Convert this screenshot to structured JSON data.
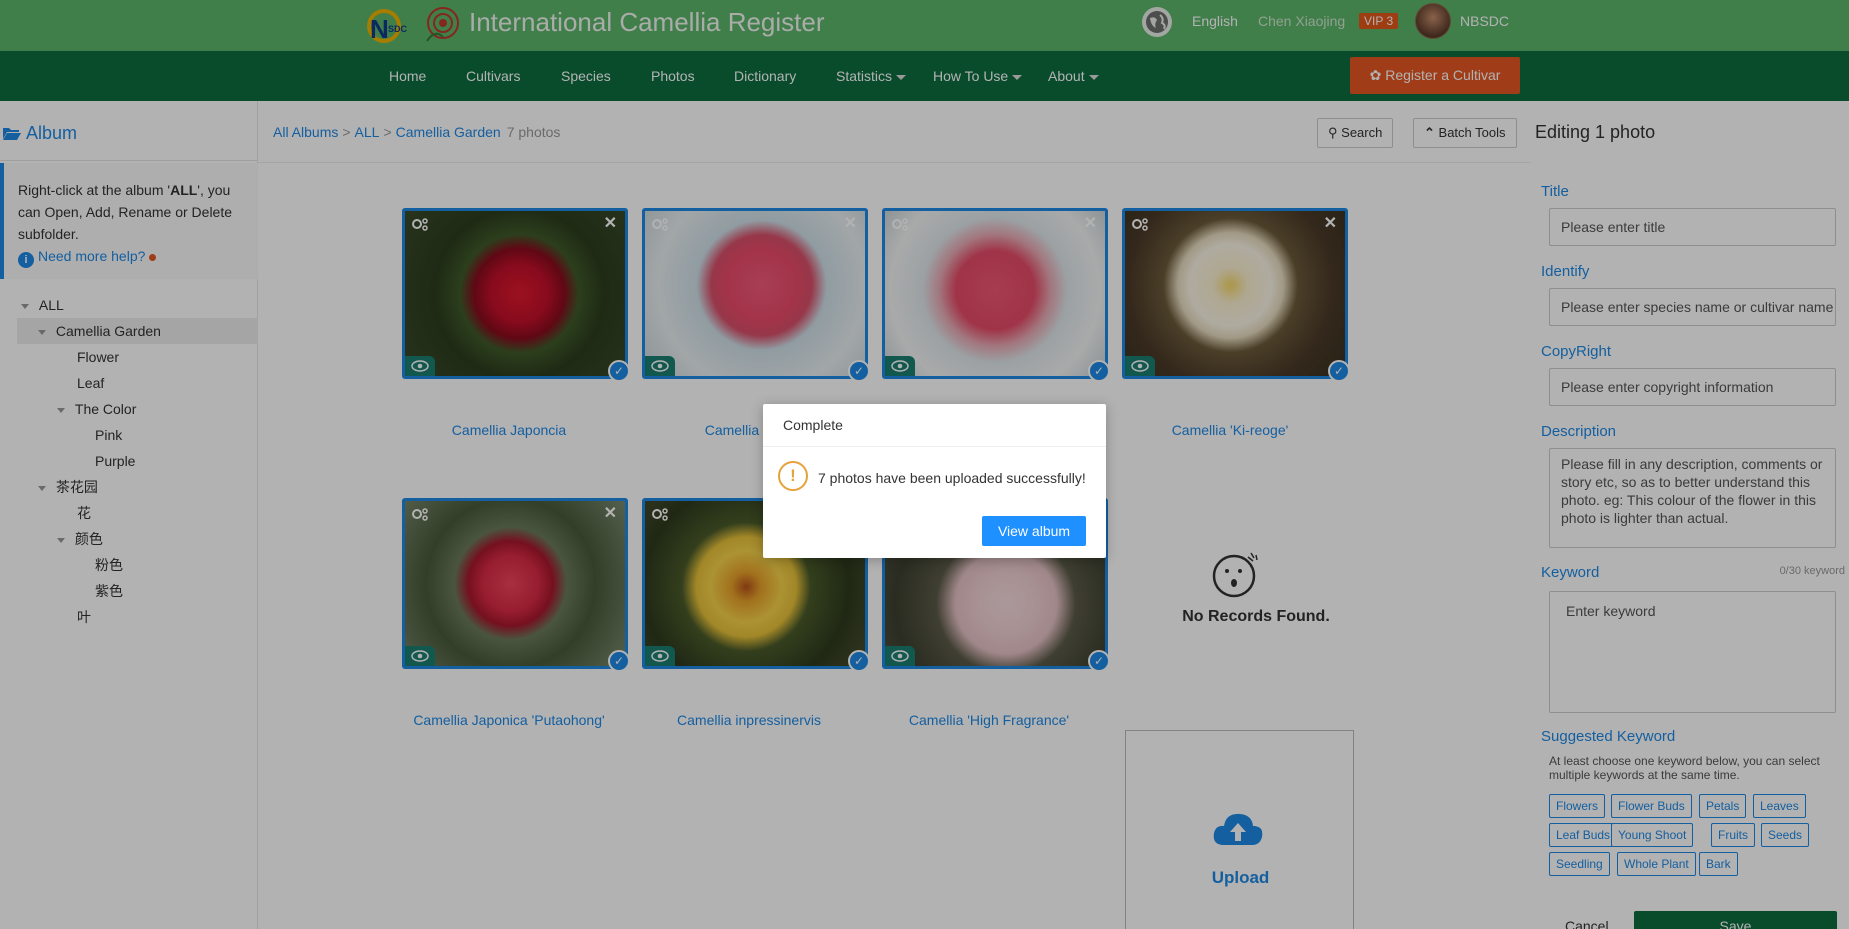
{
  "header": {
    "site_title": "International Camellia Register",
    "language": "English",
    "user_name": "Chen Xiaojing",
    "vip": "VIP 3",
    "org": "NBSDC"
  },
  "nav": {
    "items": [
      "Home",
      "Cultivars",
      "Species",
      "Photos",
      "Dictionary",
      "Statistics",
      "How To Use",
      "About"
    ],
    "register_label": "Register a Cultivar"
  },
  "sidebar": {
    "title": "Album",
    "tip_part1": "Right-click at the album '",
    "tip_bold": "ALL",
    "tip_part2": "', you can Open, Add, Rename or Delete subfolder.",
    "help": "Need more help?",
    "tree": [
      "ALL",
      "Camellia Garden",
      "Flower",
      "Leaf",
      "The Color",
      "Pink",
      "Purple",
      "茶花园",
      "花",
      "颜色",
      "粉色",
      "紫色",
      "叶"
    ]
  },
  "breadcrumb": {
    "all_albums": "All Albums",
    "all": "ALL",
    "current": "Camellia Garden",
    "count": "7 photos"
  },
  "toolbar": {
    "search": "Search",
    "batch": "Batch Tools"
  },
  "photos": [
    {
      "caption": "Camellia Japoncia"
    },
    {
      "caption": "Camellia reticu"
    },
    {
      "caption": ""
    },
    {
      "caption": "Camellia 'Ki-reoge'"
    },
    {
      "caption": "Camellia Japonica 'Putaohong'"
    },
    {
      "caption": "Camellia inpressinervis"
    },
    {
      "caption": "Camellia 'High Fragrance'"
    }
  ],
  "empty": {
    "text": "No Records Found."
  },
  "upload": {
    "label": "Upload"
  },
  "panel": {
    "title": "Editing 1 photo",
    "title_label": "Title",
    "title_placeholder": "Please enter title",
    "identify_label": "Identify",
    "identify_placeholder": "Please enter species name or cultivar name",
    "copyright_label": "CopyRight",
    "copyright_placeholder": "Please enter copyright information",
    "description_label": "Description",
    "description_placeholder": "Please fill in any description, comments or story etc, so as to better understand this photo. eg: This colour of the flower in this photo is lighter than actual.",
    "keyword_label": "Keyword",
    "keyword_count": "0/30 keyword",
    "keyword_placeholder": "Enter keyword",
    "suggested_label": "Suggested Keyword",
    "suggested_hint": "At least choose one keyword below, you can select multiple keywords at the same time.",
    "keywords": [
      "Flowers",
      "Flower Buds",
      "Petals",
      "Leaves",
      "Leaf Buds",
      "Young Shoot",
      "Fruits",
      "Seeds",
      "Seedling",
      "Whole Plant",
      "Bark"
    ],
    "cancel": "Cancel",
    "save": "Save"
  },
  "modal": {
    "title": "Complete",
    "message": "7 photos have been uploaded successfully!",
    "button": "View album"
  },
  "colors": {
    "header_green": "#5cb56a",
    "nav_green": "#0d6d3f",
    "accent_blue": "#1e88e5",
    "register_orange": "#e55722"
  }
}
